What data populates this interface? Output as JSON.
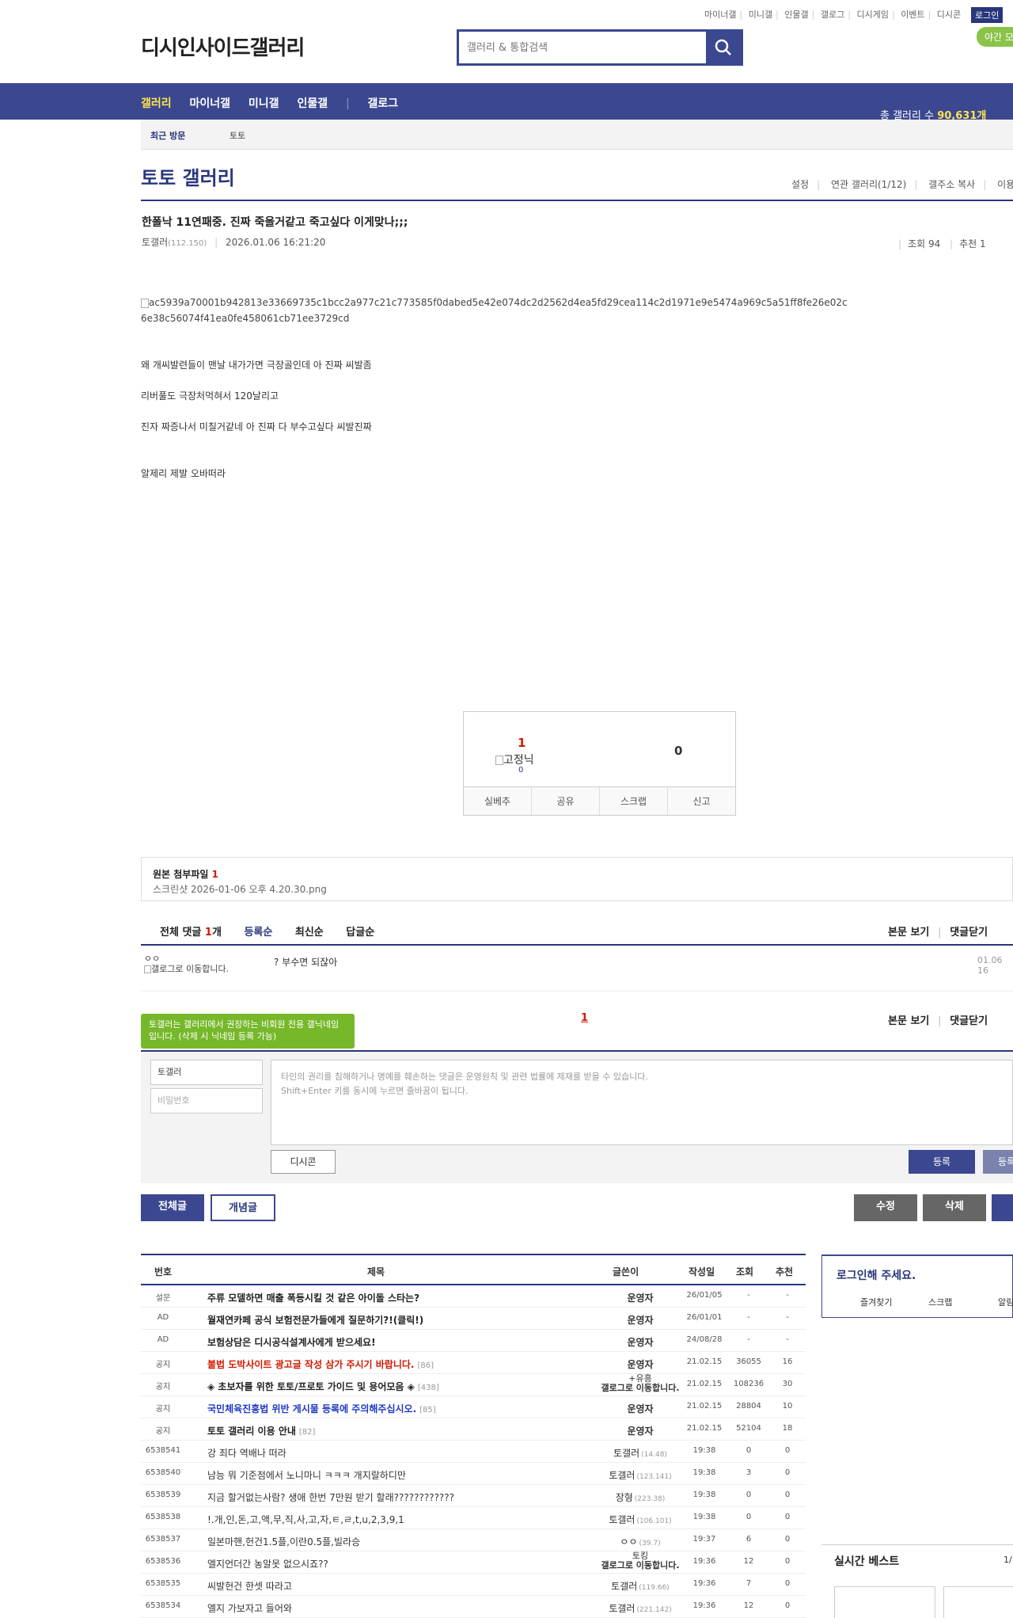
{
  "top_links": [
    "마이너갤",
    "미니갤",
    "인물갤",
    "갤로그",
    "디시게임",
    "이벤트",
    "디시콘"
  ],
  "login_label": "로그인",
  "night_label": "야간 모",
  "logo_text": "디시인사이드갤러리",
  "search_placeholder": "갤러리 & 통합검색",
  "gnb": {
    "items": [
      "갤러리",
      "마이너갤",
      "미니갤",
      "인물갤",
      "갤로그"
    ],
    "gallery_count_label": "총 갤러리 수",
    "gallery_count": "90,631개"
  },
  "recent": {
    "label": "최근 방문",
    "item": "토토"
  },
  "gallery_title": "토토 갤러리",
  "gallery_tools": [
    "설정",
    "연관 갤러리(1/12)",
    "갤주소 복사",
    "이용"
  ],
  "post": {
    "title": "한폴낙 11연패중. 진짜 죽을거같고 죽고싶다 이게맞나;;;",
    "writer": "토갤러",
    "writer_ip": "(112.150)",
    "date": "2026.01.06 16:21:20",
    "views_label": "조회 94",
    "reco_label": "추천 1",
    "image_alt": "ac5939a70001b942813e33669735c1bcc2a977c21c773585f0dabed5e42e074dc2d2562d4ea5fd29cea114c2d1971e9e5474a969c5a51ff8fe26e02c6e38c56074f41ea0fe458061cb71ee3729cd",
    "lines": [
      "왜 개씨발련들이 맨날 내가가면 극장골인데 아 진짜 씨발좀",
      "리버풀도 극장처먹혀서 120날리고",
      "진자 짜증나서 미칠거같네 아 진짜 다 부수고싶다 씨발진짜",
      "알제리 제발 오바떠라"
    ]
  },
  "vote": {
    "up": "1",
    "nick_alt": "고정닉",
    "nick_count": "0",
    "down": "0",
    "buttons": [
      "실베추",
      "공유",
      "스크랩",
      "신고"
    ]
  },
  "attach": {
    "label": "원본 첨부파일",
    "count": "1",
    "file": "스크린샷 2026-01-06 오후 4.20.30.png"
  },
  "comments_bar": {
    "total_label": "전체 댓글",
    "total": "1",
    "unit": "개",
    "sorts": [
      "등록순",
      "최신순",
      "답글순"
    ],
    "right": [
      "본문 보기",
      "댓글닫기"
    ]
  },
  "comment": {
    "nick": "ㅇㅇ",
    "img_alt": "갤로그로 이동합니다.",
    "text": "? 부수면 되잖아",
    "date": "01.06 16"
  },
  "pager_current": "1",
  "tip": "토갤러는 갤러리에서 권장하는 비회원 전용 갤닉네임입니다. (삭제 시 닉네임 등록 가능)",
  "write": {
    "nick_value": "토갤러",
    "password_placeholder": "비밀번호",
    "notice1": "타인의 권리를 침해하거나 명예를 훼손하는 댓글은 운영원칙 및 관련 법률에 제재를 받을 수 있습니다.",
    "notice2": "Shift+Enter 키를 동시에 누르면 줄바꿈이 됩니다.",
    "dccon": "디시콘",
    "register": "등록",
    "register2": "등록"
  },
  "list_buttons": {
    "all": "전체글",
    "concept": "개념글",
    "edit": "수정",
    "delete": "삭제"
  },
  "table": {
    "headers": [
      "번호",
      "제목",
      "글쓴이",
      "작성일",
      "조회",
      "추천"
    ],
    "rows": [
      {
        "num": "설문",
        "subj": "주류 모델하면 매출 폭등시킬 것 같은 아이돌 스타는?",
        "style": "bold",
        "rc": "",
        "writer": "운영자",
        "ip": "",
        "date": "26/01/05",
        "view": "-",
        "reco": "-"
      },
      {
        "num": "AD",
        "subj": "월재연카페 공식 보험전문가들에게 질문하기?!(클릭!)",
        "style": "bold",
        "rc": "",
        "writer": "운영자",
        "ip": "",
        "date": "26/01/01",
        "view": "-",
        "reco": "-"
      },
      {
        "num": "AD",
        "subj": "보험상담은 디시공식설계사에게 받으세요!",
        "style": "bold",
        "rc": "",
        "writer": "운영자",
        "ip": "",
        "date": "24/08/28",
        "view": "-",
        "reco": "-"
      },
      {
        "num": "공지",
        "subj": "불법 도박사이트 광고글 작성 삼가 주시기 바랍니다.",
        "style": "red",
        "rc": "[86]",
        "writer": "운영자",
        "ip": "",
        "date": "21.02.15",
        "view": "36055",
        "reco": "16"
      },
      {
        "num": "공지",
        "subj": "◈ 초보자를 위한 토토/프로토 가이드 및 용어모음 ◈",
        "style": "bold",
        "rc": "[438]",
        "writer": "+유흥",
        "ip": "갤로그로 이동합니다.",
        "date": "21.02.15",
        "view": "108236",
        "reco": "30"
      },
      {
        "num": "공지",
        "subj": "국민체육진흥법 위반 게시물 등록에 주의해주십시오.",
        "style": "blue",
        "rc": "[85]",
        "writer": "운영자",
        "ip": "",
        "date": "21.02.15",
        "view": "28804",
        "reco": "10"
      },
      {
        "num": "공지",
        "subj": "토토 갤러리 이용 안내",
        "style": "bold",
        "rc": "[82]",
        "writer": "운영자",
        "ip": "",
        "date": "21.02.15",
        "view": "52104",
        "reco": "18"
      },
      {
        "num": "6538541",
        "subj": "강 죄다 역배나 떠라",
        "style": "normal",
        "rc": "",
        "writer": "토갤러",
        "ip": "(14.48)",
        "date": "19:38",
        "view": "0",
        "reco": "0"
      },
      {
        "num": "6538540",
        "subj": "남능 뭐 기준점에서 노니마니 ㅋㅋㅋ 개지랄하디만",
        "style": "normal",
        "rc": "",
        "writer": "토갤러",
        "ip": "(123.141)",
        "date": "19:38",
        "view": "3",
        "reco": "0"
      },
      {
        "num": "6538539",
        "subj": "지금 할거없는사람? 생애 한번 7만원 받기 할래????????????",
        "style": "normal",
        "rc": "",
        "writer": "장형",
        "ip": "(223.38)",
        "date": "19:38",
        "view": "0",
        "reco": "0"
      },
      {
        "num": "6538538",
        "subj": "!.개,인,돈,고,액,무,직,사,고,자,ㅌ,ㄹ,t,u,2,3,9,1",
        "style": "normal",
        "rc": "",
        "writer": "토갤러",
        "ip": "(106.101)",
        "date": "19:38",
        "view": "0",
        "reco": "0"
      },
      {
        "num": "6538537",
        "subj": "일본마핸,헌건1.5플,이란0.5플,빌라승",
        "style": "normal",
        "rc": "",
        "writer": "ㅇㅇ",
        "ip": "(39.7)",
        "date": "19:37",
        "view": "6",
        "reco": "0"
      },
      {
        "num": "6538536",
        "subj": "엘지언더간 농알못 없으시죠??",
        "style": "normal",
        "rc": "",
        "writer": "토킹",
        "ip": "갤로그로 이동합니다.",
        "date": "19:36",
        "view": "12",
        "reco": "0"
      },
      {
        "num": "6538535",
        "subj": "씨발헌건 한셋 따라고",
        "style": "normal",
        "rc": "",
        "writer": "토갤러",
        "ip": "(119.66)",
        "date": "19:36",
        "view": "7",
        "reco": "0"
      },
      {
        "num": "6538534",
        "subj": "엘지 가보자고 들어와",
        "style": "normal",
        "rc": "",
        "writer": "토갤러",
        "ip": "(221.142)",
        "date": "19:36",
        "view": "12",
        "reco": "0"
      }
    ]
  },
  "side": {
    "login_prompt": "로그인해 주세요.",
    "links": [
      "즐겨찾기",
      "스크랩",
      "알림"
    ],
    "realtime_title": "실시간 베스트",
    "realtime_page": "1/"
  },
  "colors": {
    "brand": "#3b4890",
    "accent": "#ffe44d",
    "red": "#d31900",
    "green": "#76b82a"
  }
}
